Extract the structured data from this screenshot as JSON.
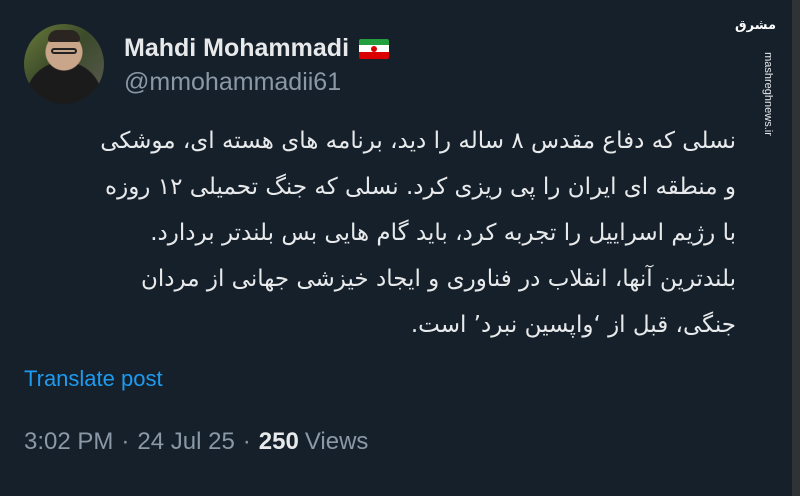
{
  "author": {
    "display_name": "Mahdi Mohammadi",
    "handle": "@mmohammadii61",
    "flag": "flag-iran-icon"
  },
  "watermark": {
    "logo_text": "مشرق",
    "url": "mashreghnews.ir"
  },
  "post": {
    "lines": [
      "نسلی که دفاع مقدس ۸ ساله را دید، برنامه های هسته ای، موشکی",
      "و منطقه ای ایران را پی ریزی کرد. نسلی که جنگ تحمیلی ۱۲ روزه",
      "با رژیم اسراییل را تجربه کرد، باید گام هایی بس بلندتر بردارد.",
      "بلندترین آنها، انقلاب در فناوری و ایجاد خیزشی جهانی از مردان",
      "جنگی، قبل از ‘واپسین نبرد’ است."
    ],
    "translate_label": "Translate post"
  },
  "meta": {
    "time": "3:02 PM",
    "separator": "·",
    "date": "24 Jul 25",
    "views_count": "250",
    "views_label": "Views"
  },
  "colors": {
    "background": "#15202b",
    "text": "#e7e9ea",
    "secondary": "#8b98a5",
    "link": "#1d9bf0"
  }
}
